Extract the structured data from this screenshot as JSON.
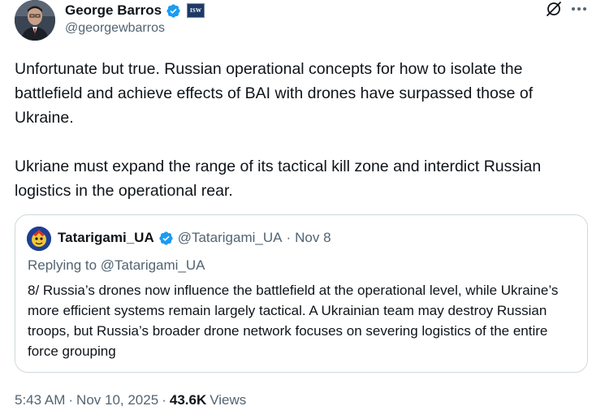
{
  "author": {
    "display_name": "George Barros",
    "handle": "@georgewbarros",
    "affiliation_badge": "ISW"
  },
  "tweet": {
    "paragraph_1": "Unfortunate but true. Russian operational concepts for how to isolate the battlefield and achieve effects of BAI with drones have surpassed those of Ukraine.",
    "paragraph_2": "Ukriane must expand the range of its tactical kill zone and interdict Russian logistics in the operational rear."
  },
  "quoted": {
    "display_name": "Tatarigami_UA",
    "handle": "@Tatarigami_UA",
    "separator": "·",
    "date": "Nov 8",
    "replying_to": "Replying to @Tatarigami_UA",
    "text": "8/ Russia’s drones now influence the battlefield at the operational level, while Ukraine’s more efficient systems remain largely tactical. A Ukrainian team may destroy Russian troops, but Russia’s broader drone network focuses on severing logistics of the entire force grouping"
  },
  "meta": {
    "time": "5:43 AM",
    "sep1": "·",
    "date": "Nov 10, 2025",
    "sep2": "·",
    "views_count": "43.6K",
    "views_label": "Views"
  },
  "icons": {
    "verified": "verified-badge-icon",
    "grok": "grok-icon",
    "more": "more-options-icon"
  },
  "colors": {
    "verified_blue": "#1d9bf0",
    "secondary_text": "#536471",
    "primary_text": "#0f1419",
    "border": "#cfd9de"
  }
}
